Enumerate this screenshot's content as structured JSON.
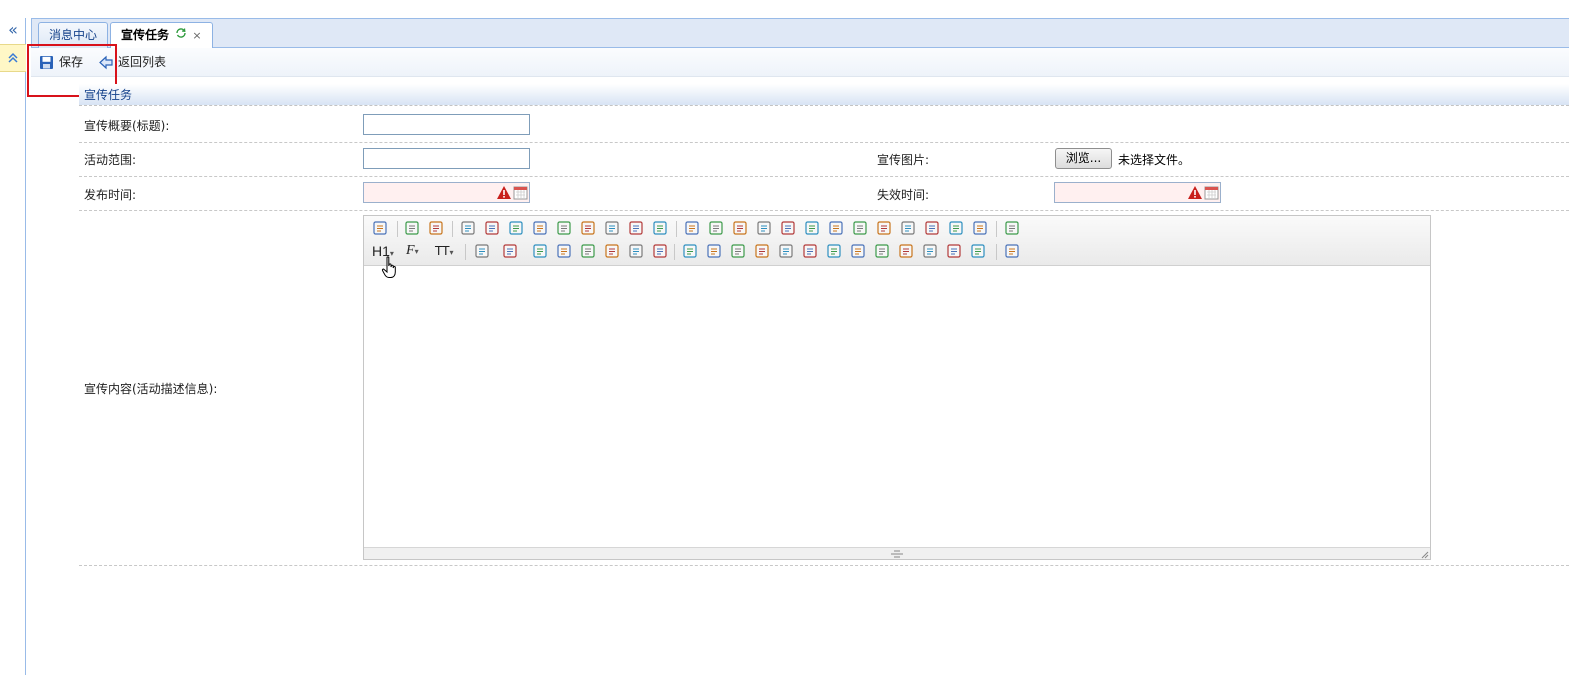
{
  "sidebar": {
    "collapse_icon": "double-chevron-left-icon",
    "expand_icon": "double-chevron-up-icon"
  },
  "tabs": [
    {
      "label": "消息中心",
      "active": false
    },
    {
      "label": "宣传任务",
      "active": true,
      "refresh_icon": "refresh-icon",
      "close_glyph": "×"
    }
  ],
  "toolbar": {
    "save_label": "保存",
    "back_label": "返回列表"
  },
  "form": {
    "section_title": "宣传任务",
    "title_label": "宣传概要(标题):",
    "title_value": "",
    "scope_label": "活动范围:",
    "scope_value": "",
    "image_label": "宣传图片:",
    "browse_label": "浏览...",
    "no_file_text": "未选择文件。",
    "publish_label": "发布时间:",
    "publish_value": "",
    "expire_label": "失效时间:",
    "expire_value": "",
    "content_label": "宣传内容(活动描述信息):"
  },
  "editor": {
    "heading_label": "H1",
    "font_label": "F",
    "size_label": "TT",
    "row1_icons": [
      "source-icon",
      "undo-icon",
      "redo-icon",
      "preview-icon",
      "print-icon",
      "template-icon",
      "code-icon",
      "cut-icon",
      "copy-icon",
      "paste-icon",
      "paste-text-icon",
      "paste-word-icon",
      "align-left-icon",
      "align-center-icon",
      "align-right-icon",
      "align-justify-icon",
      "ordered-list-icon",
      "unordered-list-icon",
      "indent-icon",
      "outdent-icon",
      "subscript-icon",
      "superscript-icon",
      "clear-format-icon",
      "quick-format-icon",
      "select-all-icon",
      "fullscreen-icon"
    ],
    "row2_icons": [
      "font-color-icon",
      "highlight-icon",
      "bold-icon",
      "italic-icon",
      "underline-icon",
      "strikethrough-icon",
      "line-height-icon",
      "remove-format-icon",
      "image-icon",
      "multi-image-icon",
      "flash-icon",
      "media-icon",
      "attachment-icon",
      "table-icon",
      "horizontal-rule-icon",
      "emoticon-icon",
      "map-icon",
      "page-break-icon",
      "anchor-icon",
      "link-icon",
      "unlink-icon",
      "help-icon"
    ]
  },
  "colors": {
    "accent": "#15428b",
    "tab_bg": "#dfe8f6",
    "highlight": "#d8121b",
    "required_bg": "#fff0f0"
  }
}
